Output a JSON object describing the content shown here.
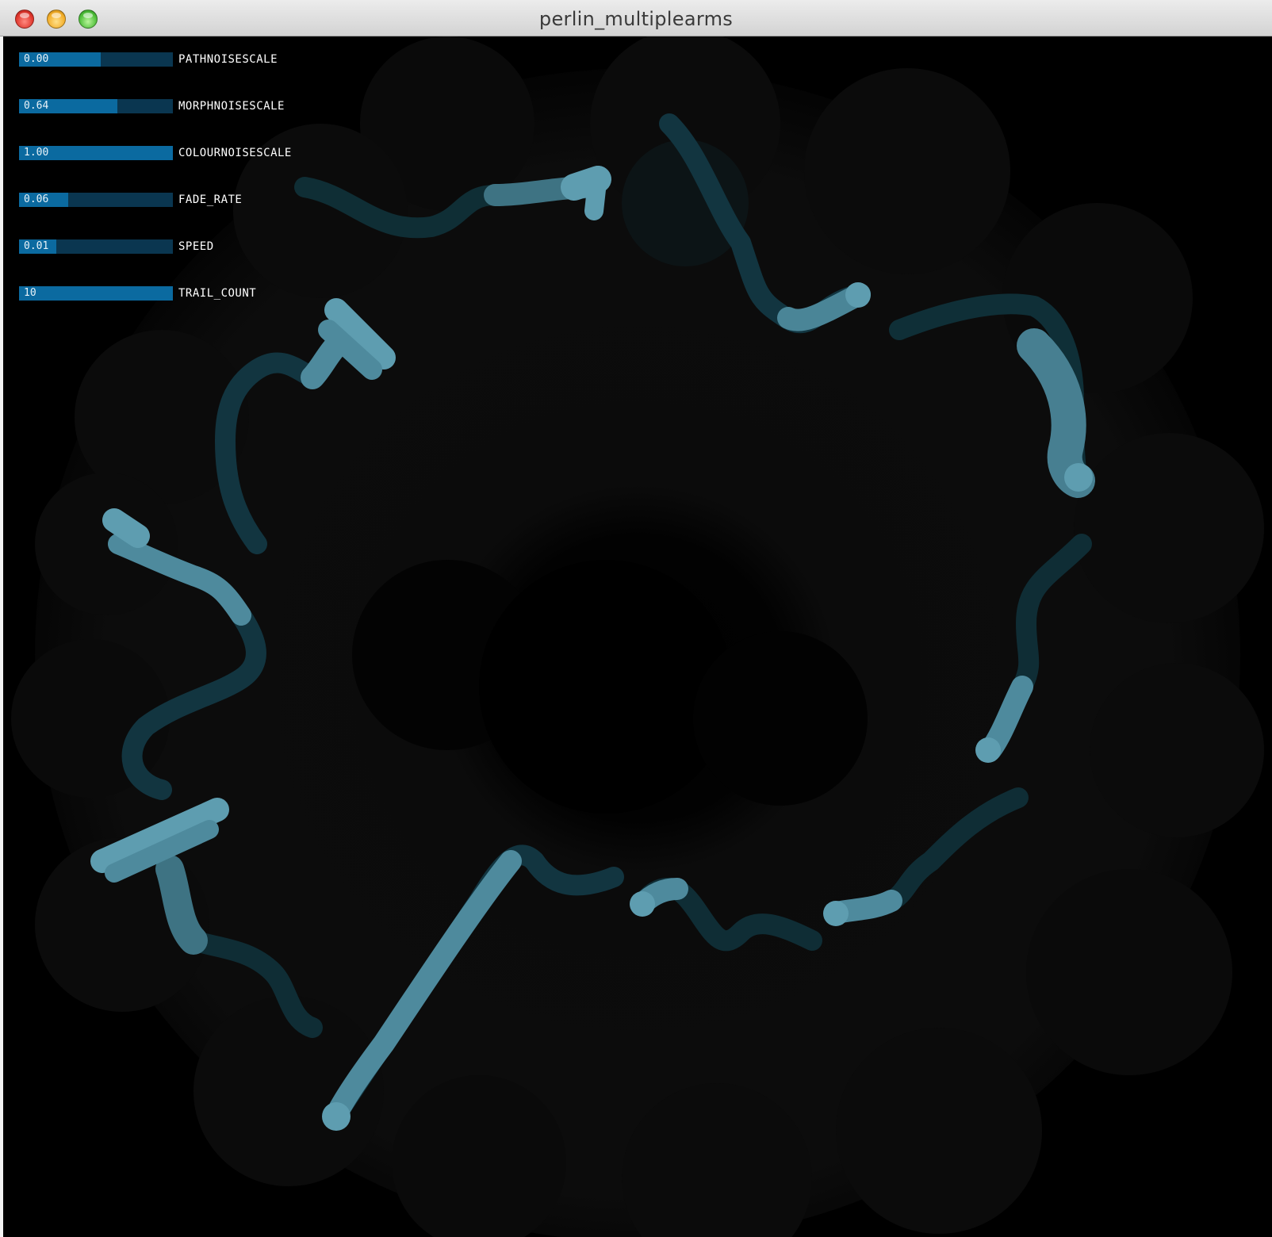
{
  "window": {
    "title": "perlin_multiplearms"
  },
  "colors": {
    "background": "#000000",
    "haze": "#0b0b0b",
    "arm_head": "#5e9db0",
    "slider_fill": "#0b6aa0",
    "slider_track": "#0a3650"
  },
  "controls": [
    {
      "value": "0.00",
      "label": "PATHNOISESCALE",
      "fill_fraction": 0.53
    },
    {
      "value": "0.64",
      "label": "MORPHNOISESCALE",
      "fill_fraction": 0.64
    },
    {
      "value": "1.00",
      "label": "COLOURNOISESCALE",
      "fill_fraction": 1.0
    },
    {
      "value": "0.06",
      "label": "FADE_RATE",
      "fill_fraction": 0.32
    },
    {
      "value": "0.01",
      "label": "SPEED",
      "fill_fraction": 0.24
    },
    {
      "value": "10",
      "label": "TRAIL_COUNT",
      "fill_fraction": 1.0
    }
  ]
}
